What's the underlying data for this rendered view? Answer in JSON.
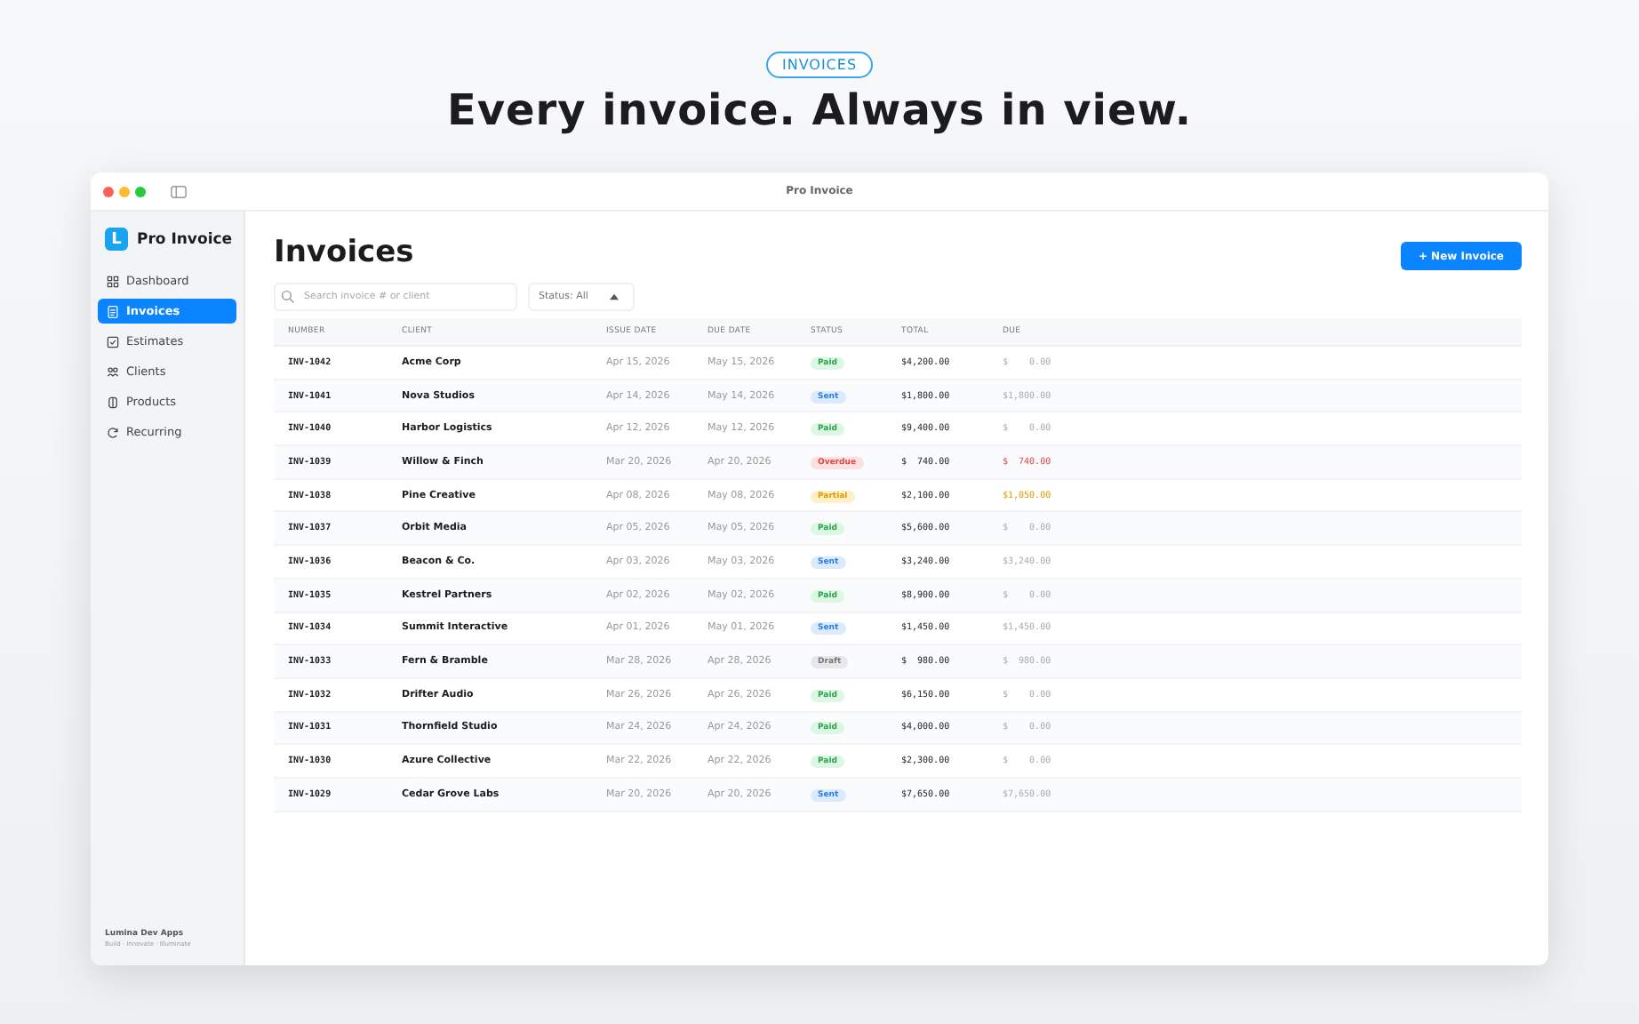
{
  "hero": {
    "badge": "INVOICES",
    "headline": "Every invoice. Always in view."
  },
  "window": {
    "title": "Pro Invoice"
  },
  "sidebar": {
    "app_name": "Pro Invoice",
    "logo_letter": "L",
    "items": [
      {
        "label": "Dashboard",
        "selected": false
      },
      {
        "label": "Invoices",
        "selected": true
      },
      {
        "label": "Estimates",
        "selected": false
      },
      {
        "label": "Clients",
        "selected": false
      },
      {
        "label": "Products",
        "selected": false
      },
      {
        "label": "Recurring",
        "selected": false
      }
    ],
    "footer": {
      "company": "Lumina Dev Apps",
      "tagline": "Build · Innovate · Illuminate"
    }
  },
  "page": {
    "title": "Invoices",
    "new_button": "+ New Invoice",
    "search": {
      "placeholder": "Search invoice # or client"
    },
    "status_filter": {
      "value": "Status: All"
    }
  },
  "table": {
    "columns": [
      "NUMBER",
      "CLIENT",
      "ISSUE DATE",
      "DUE DATE",
      "STATUS",
      "TOTAL",
      "DUE"
    ],
    "rows": [
      {
        "number": "INV-1042",
        "client": "Acme Corp",
        "issue": "Apr 15, 2026",
        "due_date": "May 15, 2026",
        "status": {
          "label": "Paid",
          "kind": "paid"
        },
        "total": "$4,200.00",
        "due": "$    0.00"
      },
      {
        "number": "INV-1041",
        "client": "Nova Studios",
        "issue": "Apr 14, 2026",
        "due_date": "May 14, 2026",
        "status": {
          "label": "Sent",
          "kind": "sent"
        },
        "total": "$1,800.00",
        "due": "$1,800.00"
      },
      {
        "number": "INV-1040",
        "client": "Harbor Logistics",
        "issue": "Apr 12, 2026",
        "due_date": "May 12, 2026",
        "status": {
          "label": "Paid",
          "kind": "paid"
        },
        "total": "$9,400.00",
        "due": "$    0.00"
      },
      {
        "number": "INV-1039",
        "client": "Willow & Finch",
        "issue": "Mar 20, 2026",
        "due_date": "Apr 20, 2026",
        "status": {
          "label": "Overdue",
          "kind": "overdue"
        },
        "total": "$  740.00",
        "due": "$  740.00"
      },
      {
        "number": "INV-1038",
        "client": "Pine Creative",
        "issue": "Apr 08, 2026",
        "due_date": "May 08, 2026",
        "status": {
          "label": "Partial",
          "kind": "partial"
        },
        "total": "$2,100.00",
        "due": "$1,050.00"
      },
      {
        "number": "INV-1037",
        "client": "Orbit Media",
        "issue": "Apr 05, 2026",
        "due_date": "May 05, 2026",
        "status": {
          "label": "Paid",
          "kind": "paid"
        },
        "total": "$5,600.00",
        "due": "$    0.00"
      },
      {
        "number": "INV-1036",
        "client": "Beacon & Co.",
        "issue": "Apr 03, 2026",
        "due_date": "May 03, 2026",
        "status": {
          "label": "Sent",
          "kind": "sent"
        },
        "total": "$3,240.00",
        "due": "$3,240.00"
      },
      {
        "number": "INV-1035",
        "client": "Kestrel Partners",
        "issue": "Apr 02, 2026",
        "due_date": "May 02, 2026",
        "status": {
          "label": "Paid",
          "kind": "paid"
        },
        "total": "$8,900.00",
        "due": "$    0.00"
      },
      {
        "number": "INV-1034",
        "client": "Summit Interactive",
        "issue": "Apr 01, 2026",
        "due_date": "May 01, 2026",
        "status": {
          "label": "Sent",
          "kind": "sent"
        },
        "total": "$1,450.00",
        "due": "$1,450.00"
      },
      {
        "number": "INV-1033",
        "client": "Fern & Bramble",
        "issue": "Mar 28, 2026",
        "due_date": "Apr 28, 2026",
        "status": {
          "label": "Draft",
          "kind": "draft"
        },
        "total": "$  980.00",
        "due": "$  980.00"
      },
      {
        "number": "INV-1032",
        "client": "Drifter Audio",
        "issue": "Mar 26, 2026",
        "due_date": "Apr 26, 2026",
        "status": {
          "label": "Paid",
          "kind": "paid"
        },
        "total": "$6,150.00",
        "due": "$    0.00"
      },
      {
        "number": "INV-1031",
        "client": "Thornfield Studio",
        "issue": "Mar 24, 2026",
        "due_date": "Apr 24, 2026",
        "status": {
          "label": "Paid",
          "kind": "paid"
        },
        "total": "$4,000.00",
        "due": "$    0.00"
      },
      {
        "number": "INV-1030",
        "client": "Azure Collective",
        "issue": "Mar 22, 2026",
        "due_date": "Apr 22, 2026",
        "status": {
          "label": "Paid",
          "kind": "paid"
        },
        "total": "$2,300.00",
        "due": "$    0.00"
      },
      {
        "number": "INV-1029",
        "client": "Cedar Grove Labs",
        "issue": "Mar 20, 2026",
        "due_date": "Apr 20, 2026",
        "status": {
          "label": "Sent",
          "kind": "sent"
        },
        "total": "$7,650.00",
        "due": "$7,650.00"
      }
    ]
  }
}
